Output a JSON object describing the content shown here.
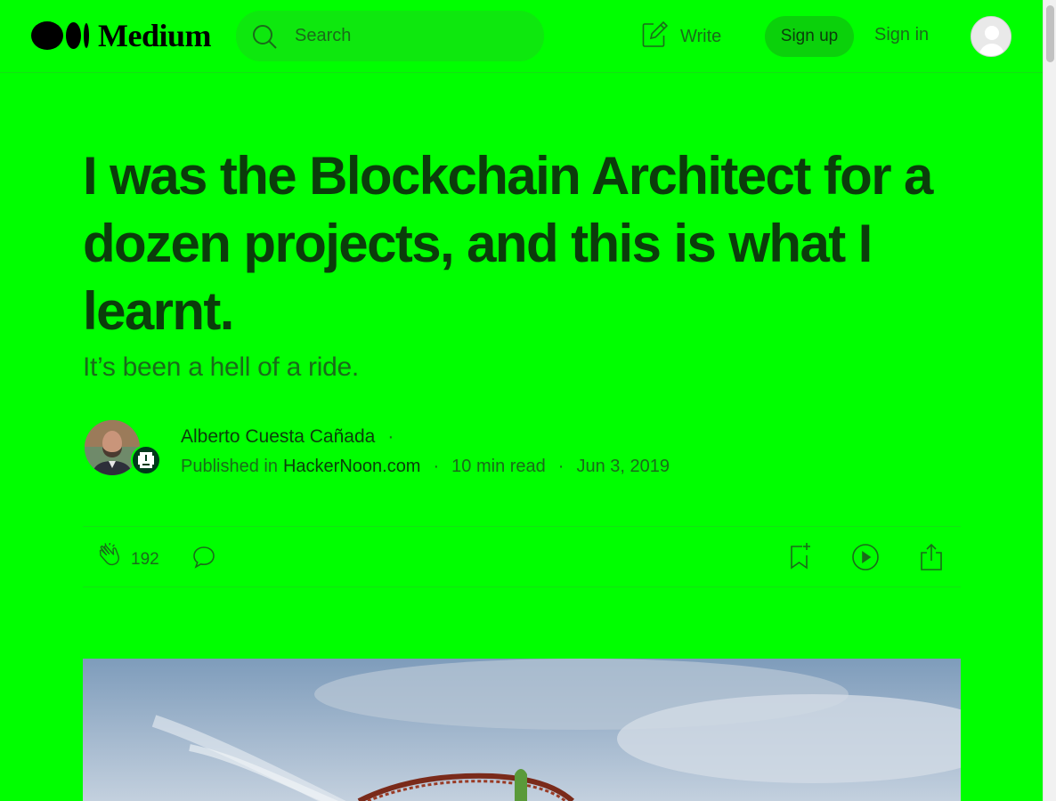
{
  "header": {
    "logo_text": "Medium",
    "search_placeholder": "Search",
    "write_label": "Write",
    "signup_label": "Sign up",
    "signin_label": "Sign in"
  },
  "article": {
    "title": "I was the Blockchain Architect for a dozen projects, and this is what I learnt.",
    "subtitle": "It’s been a hell of a ride.",
    "author": "Alberto Cuesta Cañada",
    "published_in_label": "Published in",
    "publication": "HackerNoon.com",
    "read_time": "10 min read",
    "date": "Jun 3, 2019",
    "separator": "·"
  },
  "actions": {
    "clap_count": "192"
  },
  "icons": {
    "search": "search-icon",
    "write": "write-icon",
    "clap": "clap-icon",
    "comment": "comment-icon",
    "bookmark": "bookmark-add-icon",
    "listen": "play-icon",
    "share": "share-icon"
  },
  "colors": {
    "background": "#00ff00",
    "text_primary": "#0b3d0b",
    "text_secondary": "#1a6b1a",
    "signup_bg": "#0bd10b"
  }
}
